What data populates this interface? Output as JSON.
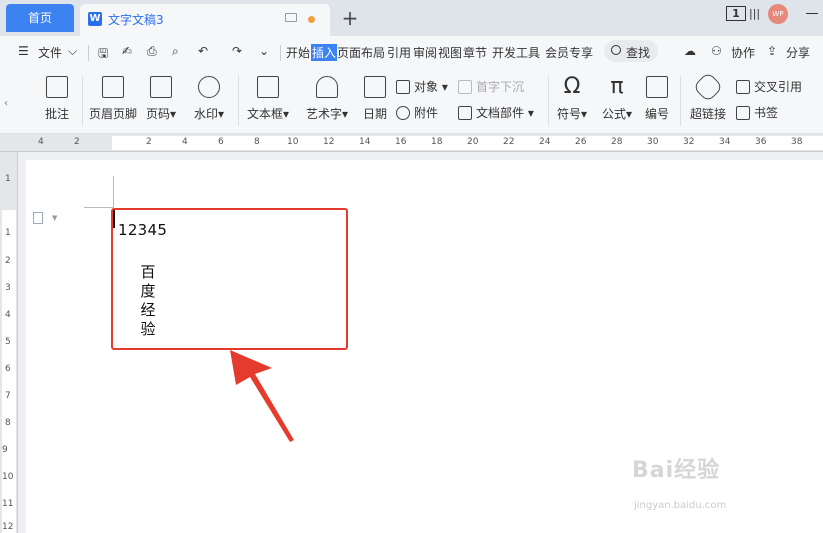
{
  "tabs": {
    "home_label": "首页",
    "doc_title": "文字文稿3",
    "doc_icon_letter": "W",
    "new_tab_symbol": "+"
  },
  "titlebar": {
    "badge_text": "1",
    "avatar_text": "WP"
  },
  "menu": {
    "file_label": "文件",
    "items": [
      "开始",
      "插入",
      "页面布局",
      "引用",
      "审阅",
      "视图",
      "章节",
      "开发工具",
      "会员专享"
    ],
    "active_item": "插入",
    "search_label": "查找",
    "collab_label": "协作",
    "share_label": "分享"
  },
  "ribbon": {
    "comment": "批注",
    "header_footer": "页眉页脚",
    "page_number": "页码",
    "watermark": "水印",
    "text_box": "文本框",
    "art_text": "艺术字",
    "date": "日期",
    "object": "对象",
    "drop_cap": "首字下沉",
    "attachment": "附件",
    "doc_parts": "文档部件",
    "symbol": "符号",
    "formula": "公式",
    "numbering": "编号",
    "hyperlink": "超链接",
    "cross_reference": "交叉引用",
    "bookmark": "书签"
  },
  "ruler": {
    "horizontal": [
      "4",
      "2",
      "2",
      "4",
      "6",
      "8",
      "10",
      "12",
      "14",
      "16",
      "18",
      "20",
      "22",
      "24",
      "26",
      "28",
      "30",
      "32",
      "34",
      "36",
      "38"
    ],
    "vertical": [
      "1",
      "1",
      "2",
      "3",
      "4",
      "5",
      "6",
      "7",
      "8",
      "9",
      "10",
      "11",
      "12"
    ]
  },
  "document": {
    "line1": "12345",
    "vertical_chars": [
      "百",
      "度",
      "经",
      "验"
    ]
  },
  "watermark": {
    "brand": "Bai经验",
    "url": "jingyan.baidu.com"
  },
  "colors": {
    "accent": "#3c82f0",
    "highlight_box": "#e53b2e"
  }
}
